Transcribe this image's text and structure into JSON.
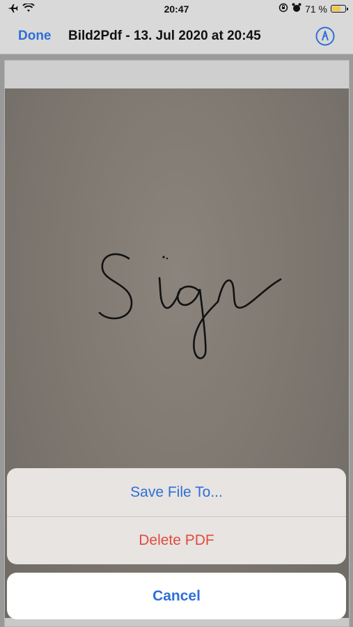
{
  "status_bar": {
    "time": "20:47",
    "battery_percent_text": "71 %",
    "battery_level": 0.71,
    "left_icons": [
      "airplane-icon",
      "wifi-icon"
    ],
    "right_icons": [
      "lock-rotation-icon",
      "alarm-icon"
    ]
  },
  "nav_bar": {
    "done_label": "Done",
    "title": "Bild2Pdf - 13. Jul 2020 at 20:45",
    "markup_icon": "markup-pen-icon"
  },
  "document": {
    "handwritten_text": "Sign"
  },
  "action_sheet": {
    "save_label": "Save File To...",
    "delete_label": "Delete PDF",
    "cancel_label": "Cancel"
  },
  "colors": {
    "accent": "#2d6fd6",
    "destructive": "#e24b40"
  }
}
